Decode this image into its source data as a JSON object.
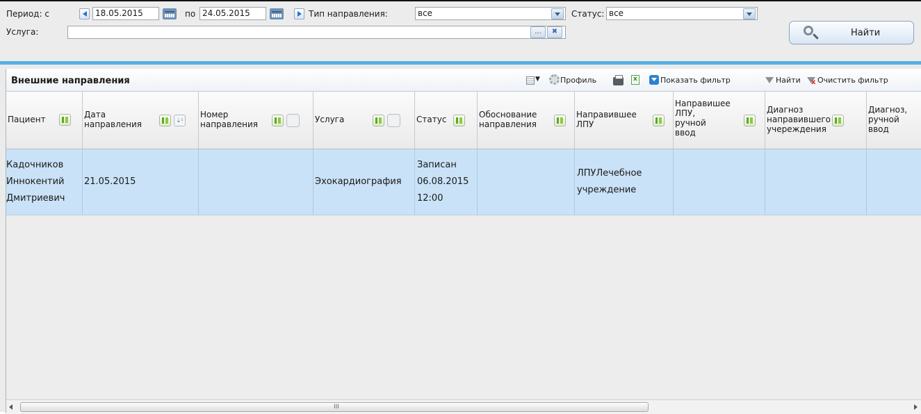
{
  "filter": {
    "period_label": "Период: с",
    "date_from": "18.05.2015",
    "to_label": "по",
    "date_to": "24.05.2015",
    "type_label": "Тип направления:",
    "type_value": "все",
    "status_label": "Статус:",
    "status_value": "все",
    "service_label": "Услуга:",
    "service_value": "",
    "service_browse": "...",
    "find_label": "Найти"
  },
  "grid": {
    "title": "Внешние направления",
    "toolbar": {
      "profile": "Профиль",
      "show_filter": "Показать фильтр",
      "find": "Найти",
      "clear_filter": "Очистить фильтр"
    },
    "columns": [
      {
        "line1": "Пациент",
        "line2": "",
        "line3": "",
        "line4": ""
      },
      {
        "line1": "Дата",
        "line2": "направления",
        "line3": "",
        "line4": ""
      },
      {
        "line1": "Номер",
        "line2": "направления",
        "line3": "",
        "line4": ""
      },
      {
        "line1": "Услуга",
        "line2": "",
        "line3": "",
        "line4": ""
      },
      {
        "line1": "Статус",
        "line2": "",
        "line3": "",
        "line4": ""
      },
      {
        "line1": "Обоснование",
        "line2": "направления",
        "line3": "",
        "line4": ""
      },
      {
        "line1": "Направившее",
        "line2": "ЛПУ",
        "line3": "",
        "line4": ""
      },
      {
        "line1": "Направишее",
        "line2": "ЛПУ,",
        "line3": "ручной",
        "line4": "ввод"
      },
      {
        "line1": "Диагноз",
        "line2": "направившего",
        "line3": "учереждения",
        "line4": ""
      },
      {
        "line1": "Диагноз,",
        "line2": "ручной",
        "line3": "ввод",
        "line4": ""
      }
    ],
    "rows": [
      {
        "patient": [
          "Кадочников",
          "Иннокентий",
          "Дмитриевич"
        ],
        "date": "21.05.2015",
        "number": "",
        "service": "Эхокардиография",
        "status": [
          "Записан",
          "06.08.2015",
          "12:00"
        ],
        "reason": "",
        "lpu": [
          "ЛПУЛечебное",
          "учреждение"
        ],
        "lpu_manual": "",
        "diagnosis": "",
        "diagnosis_manual": ""
      }
    ],
    "scrollbar_grip": "III"
  }
}
